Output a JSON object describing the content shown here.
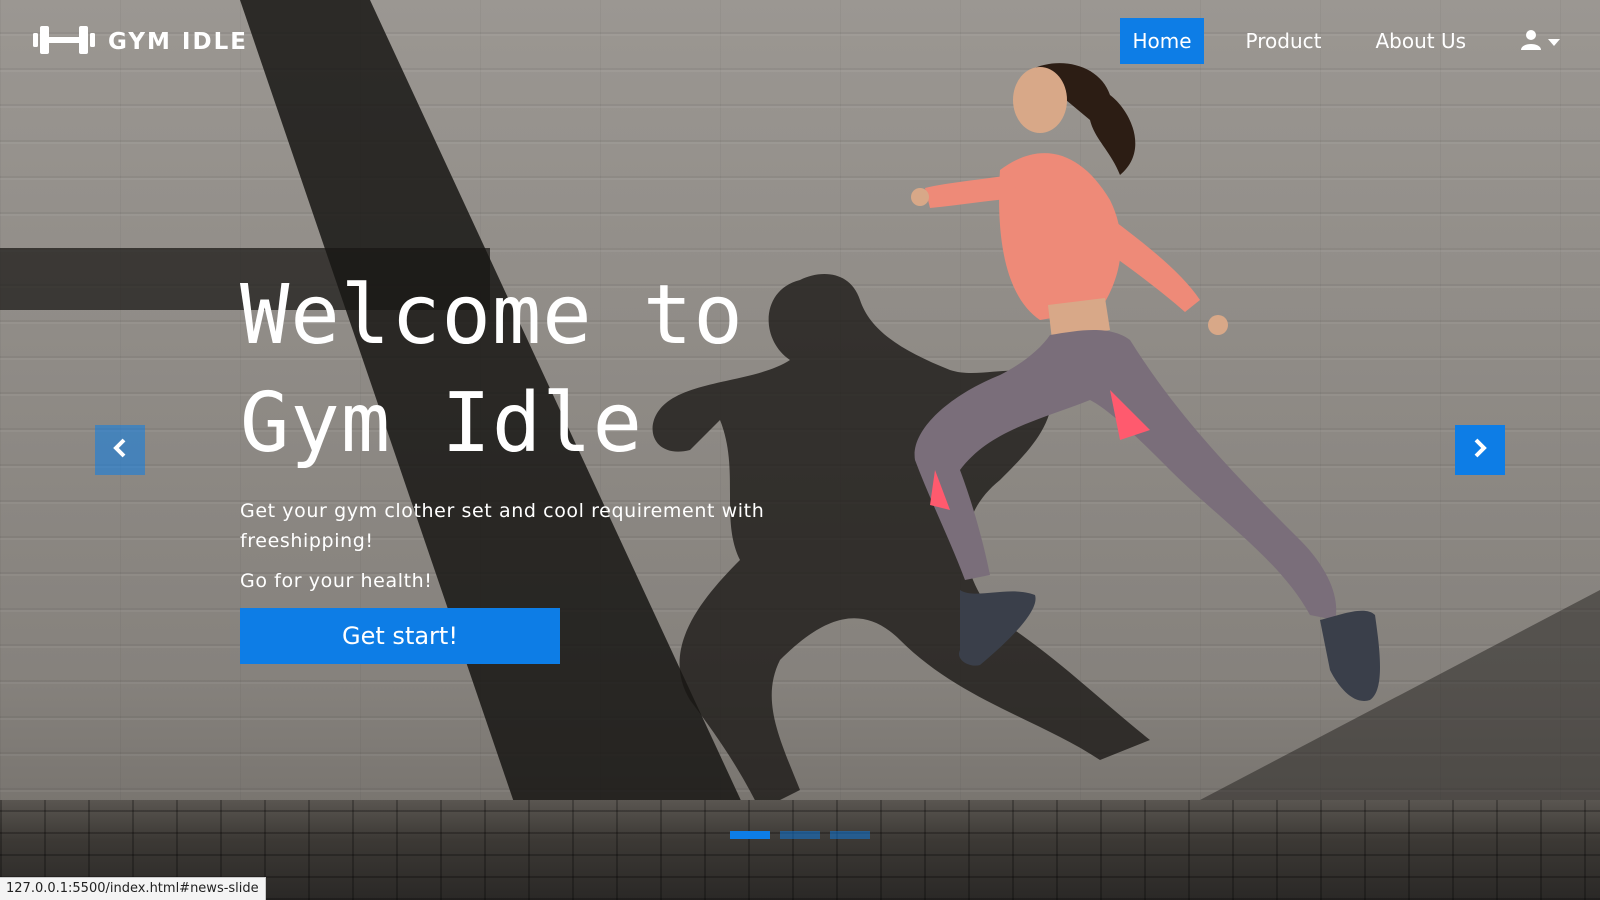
{
  "brand": {
    "name": "GYM IDLE",
    "logo_icon": "dumbbell-icon"
  },
  "nav": {
    "links": [
      {
        "label": "Home",
        "active": true
      },
      {
        "label": "Product",
        "active": false
      },
      {
        "label": "About Us",
        "active": false
      }
    ],
    "user_icon": "user-icon",
    "dropdown_icon": "caret-down-icon"
  },
  "hero": {
    "title_line1": "Welcome to",
    "title_line2": "Gym Idle",
    "subtitle": "Get your gym clother set and cool requirement with freeshipping!",
    "tagline": "Go for your health!",
    "cta_label": "Get start!"
  },
  "carousel": {
    "prev_icon": "chevron-left-icon",
    "next_icon": "chevron-right-icon",
    "slide_count": 3,
    "active_index": 0
  },
  "status_bar": {
    "url": "127.0.0.1:5500/index.html#news-slide"
  },
  "colors": {
    "accent": "#0d7de6",
    "text": "#ffffff",
    "wall": "#8f8b86"
  }
}
